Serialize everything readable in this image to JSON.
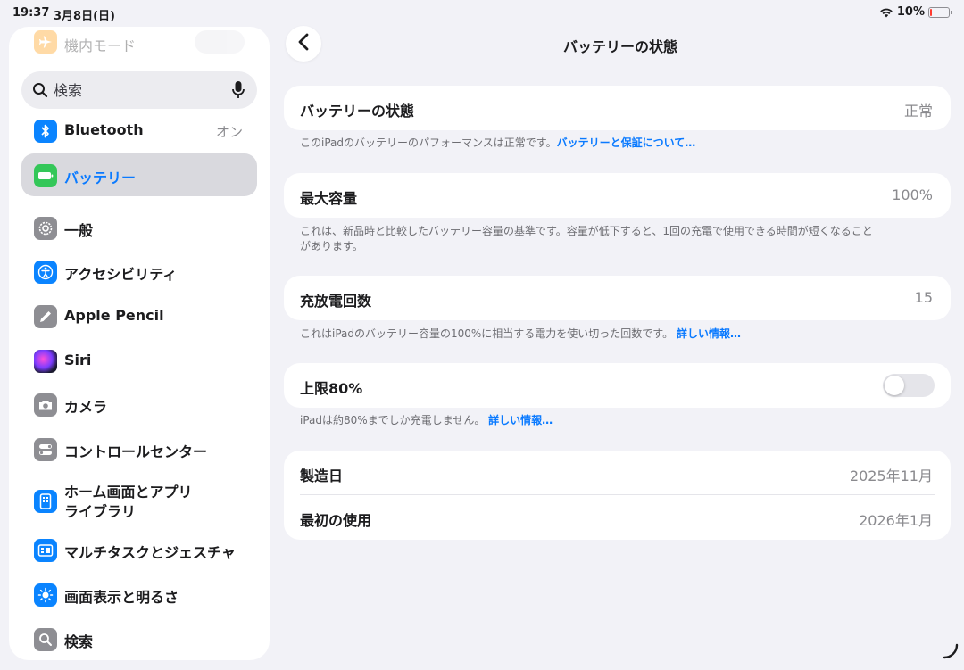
{
  "status_bar": {
    "time": "19:37",
    "date": "3月8日(日)",
    "battery_percent": "10%",
    "battery_level": 0.1,
    "battery_color": "#ff3b30"
  },
  "sidebar": {
    "airplane_label": "機内モード",
    "search_placeholder": "検索",
    "bluetooth": {
      "label": "Bluetooth",
      "value": "オン"
    },
    "items": [
      {
        "label": "バッテリー",
        "icon": "battery-icon",
        "color": "#34c759",
        "selected": true
      },
      {
        "label": "一般",
        "icon": "gear-icon",
        "color": "#8e8e93"
      },
      {
        "label": "アクセシビリティ",
        "icon": "accessibility-icon",
        "color": "#0a84ff"
      },
      {
        "label": "Apple Pencil",
        "icon": "pencil-icon",
        "color": "#8e8e93"
      },
      {
        "label": "Siri",
        "icon": "siri-icon",
        "color": "#1c1c1e"
      },
      {
        "label": "カメラ",
        "icon": "camera-icon",
        "color": "#8e8e93"
      },
      {
        "label": "コントロールセンター",
        "icon": "control-center-icon",
        "color": "#8e8e93"
      },
      {
        "label": "ホーム画面とアプリライブラリ",
        "icon": "home-screen-icon",
        "color": "#0a84ff"
      },
      {
        "label": "マルチタスクとジェスチャ",
        "icon": "multitask-icon",
        "color": "#0a84ff"
      },
      {
        "label": "画面表示と明るさ",
        "icon": "brightness-icon",
        "color": "#0a84ff"
      },
      {
        "label": "検索",
        "icon": "search-icon",
        "color": "#8e8e93"
      }
    ],
    "home_line1": "ホーム画面とアプリ",
    "home_line2": "ライブラリ"
  },
  "main": {
    "title": "バッテリーの状態",
    "health": {
      "label": "バッテリーの状態",
      "value": "正常"
    },
    "health_footer": "このiPadのバッテリーのパフォーマンスは正常です。",
    "health_link": "バッテリーと保証について…",
    "capacity": {
      "label": "最大容量",
      "value": "100%"
    },
    "capacity_footer": "これは、新品時と比較したバッテリー容量の基準です。容量が低下すると、1回の充電で使用できる時間が短くなることがあります。",
    "cycles": {
      "label": "充放電回数",
      "value": "15"
    },
    "cycles_footer": "これはiPadのバッテリー容量の100%に相当する電力を使い切った回数です。",
    "cycles_link": "詳しい情報…",
    "limit": {
      "label": "上限80%",
      "enabled": false
    },
    "limit_footer": "iPadは約80%までしか充電しません。",
    "limit_link": "詳しい情報…",
    "manufactured": {
      "label": "製造日",
      "value": "2025年11月"
    },
    "first_use": {
      "label": "最初の使用",
      "value": "2026年1月"
    }
  }
}
